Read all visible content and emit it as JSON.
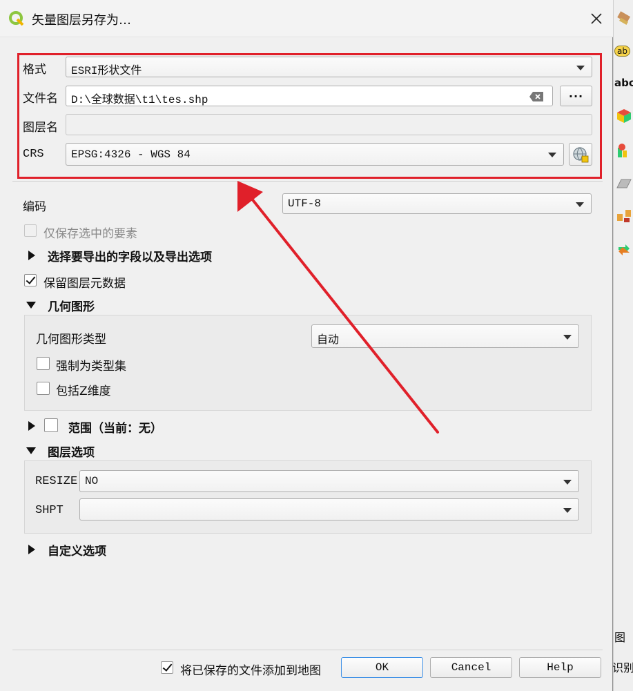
{
  "dialog": {
    "title": "矢量图层另存为…",
    "close_glyph": "✕"
  },
  "fields": {
    "format_label": "格式",
    "format_value": "ESRI形状文件",
    "filename_label": "文件名",
    "filename_value": "D:\\全球数据\\t1\\tes.shp",
    "browse_label": "···",
    "layername_label": "图层名",
    "layername_value": "",
    "crs_label": "CRS",
    "crs_value": "EPSG:4326 - WGS 84",
    "encoding_label": "编码",
    "encoding_value": "UTF-8"
  },
  "options": {
    "save_selected_only": "仅保存选中的要素",
    "select_fields": "选择要导出的字段以及导出选项",
    "keep_metadata": "保留图层元数据"
  },
  "geometry": {
    "section_title": "几何图形",
    "type_label": "几何图形类型",
    "type_value": "自动",
    "force_multi": "强制为类型集",
    "include_z": "包括Z维度"
  },
  "extent": {
    "section_title": "范围（当前：无）"
  },
  "layer_options": {
    "section_title": "图层选项",
    "resize_label": "RESIZE",
    "resize_value": "NO",
    "shpt_label": "SHPT",
    "shpt_value": ""
  },
  "custom_options": {
    "section_title": "自定义选项"
  },
  "footer": {
    "add_to_map": "将已保存的文件添加到地图",
    "ok": "OK",
    "cancel": "Cancel",
    "help": "Help"
  },
  "background_toolbar": {
    "label_abc_1": "ab",
    "label_abc_2": "abc",
    "side_text_1": "图",
    "side_text_2": "识别"
  },
  "colors": {
    "highlight": "#e0202a",
    "arrow": "#e0202a",
    "default_button_border": "#3a8ee6"
  }
}
